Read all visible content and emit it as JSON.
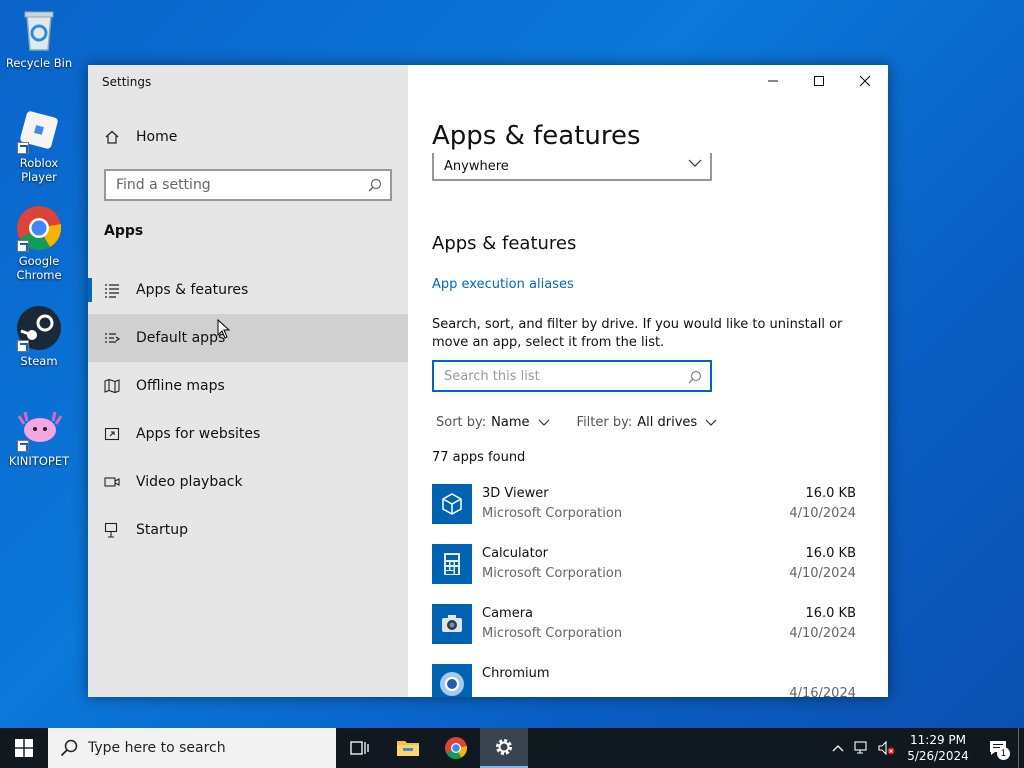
{
  "desktop": {
    "icons": [
      {
        "label": "Recycle Bin"
      },
      {
        "label": "Roblox Player"
      },
      {
        "label": "Google Chrome"
      },
      {
        "label": "Steam"
      },
      {
        "label": "KINITOPET"
      }
    ]
  },
  "window": {
    "title": "Settings",
    "sidebar": {
      "home": "Home",
      "search_placeholder": "Find a setting",
      "section": "Apps",
      "items": [
        {
          "label": "Apps & features",
          "icon": "list-icon",
          "active": true
        },
        {
          "label": "Default apps",
          "icon": "default-apps-icon"
        },
        {
          "label": "Offline maps",
          "icon": "map-icon"
        },
        {
          "label": "Apps for websites",
          "icon": "web-app-icon"
        },
        {
          "label": "Video playback",
          "icon": "video-icon"
        },
        {
          "label": "Startup",
          "icon": "startup-icon"
        }
      ]
    },
    "content": {
      "page_title": "Apps & features",
      "dropdown_value": "Anywhere",
      "subtitle": "Apps & features",
      "link": "App execution aliases",
      "description": "Search, sort, and filter by drive. If you would like to uninstall or move an app, select it from the list.",
      "search_placeholder": "Search this list",
      "sort_label": "Sort by:",
      "sort_value": "Name",
      "filter_label": "Filter by:",
      "filter_value": "All drives",
      "count": "77 apps found",
      "apps": [
        {
          "name": "3D Viewer",
          "publisher": "Microsoft Corporation",
          "size": "16.0 KB",
          "date": "4/10/2024"
        },
        {
          "name": "Calculator",
          "publisher": "Microsoft Corporation",
          "size": "16.0 KB",
          "date": "4/10/2024"
        },
        {
          "name": "Camera",
          "publisher": "Microsoft Corporation",
          "size": "16.0 KB",
          "date": "4/10/2024"
        },
        {
          "name": "Chromium",
          "publisher": "",
          "size": "",
          "date": "4/16/2024"
        }
      ]
    }
  },
  "taskbar": {
    "search_placeholder": "Type here to search",
    "time": "11:29 PM",
    "date": "5/26/2024",
    "notifications": "1"
  },
  "colors": {
    "accent": "#0067c0",
    "app_tile": "#0063b1",
    "sidebar_bg": "#e6e6e6"
  }
}
